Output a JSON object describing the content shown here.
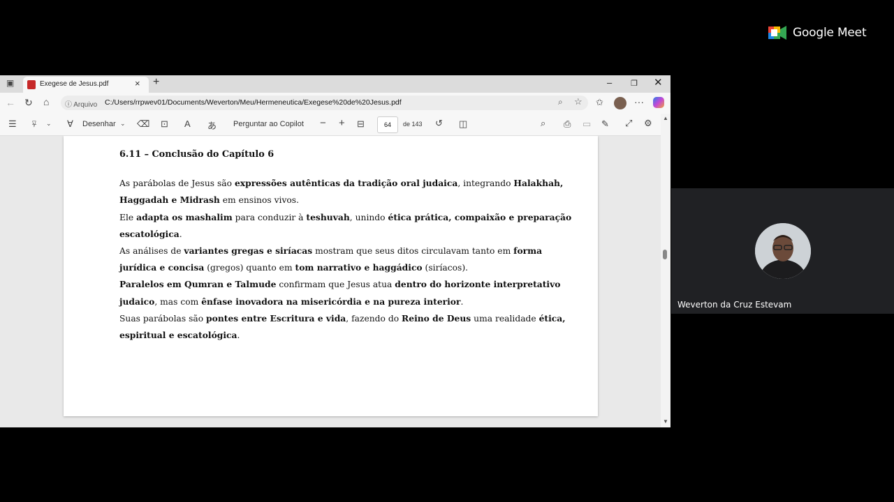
{
  "meet": {
    "brand": "Google Meet"
  },
  "participant": {
    "name": "Weverton da Cruz Estevam"
  },
  "browser": {
    "tab_title": "Exegese de Jesus.pdf",
    "address_prefix": "Arquivo",
    "url": "C:/Users/rrpwev01/Documents/Weverton/Meu/Hermeneutica/Exegese%20de%20Jesus.pdf"
  },
  "pdf_toolbar": {
    "draw_label": "Desenhar",
    "copilot_label": "Perguntar ao Copilot",
    "page_current": "64",
    "page_total_label": "de 143"
  },
  "document": {
    "heading": "6.11 – Conclusão do Capítulo 6",
    "paragraphs": [
      [
        {
          "t": "As parábolas de Jesus são "
        },
        {
          "t": "expressões autênticas da tradição oral judaica",
          "b": true
        },
        {
          "t": ", integrando "
        },
        {
          "t": "Halakhah, Haggadah e Midrash",
          "b": true
        },
        {
          "t": " em ensinos vivos."
        }
      ],
      [
        {
          "t": "Ele "
        },
        {
          "t": "adapta os mashalim",
          "b": true
        },
        {
          "t": " para conduzir à "
        },
        {
          "t": "teshuvah",
          "b": true
        },
        {
          "t": ", unindo "
        },
        {
          "t": "ética prática, compaixão e preparação escatológica",
          "b": true
        },
        {
          "t": "."
        }
      ],
      [
        {
          "t": "As análises de "
        },
        {
          "t": "variantes gregas e siríacas",
          "b": true
        },
        {
          "t": " mostram que seus ditos circulavam tanto em "
        },
        {
          "t": "forma jurídica e concisa",
          "b": true
        },
        {
          "t": " (gregos) quanto em "
        },
        {
          "t": "tom narrativo e haggádico",
          "b": true
        },
        {
          "t": " (siríacos)."
        }
      ],
      [
        {
          "t": "Paralelos em Qumran e Talmude",
          "b": true
        },
        {
          "t": " confirmam que Jesus atua "
        },
        {
          "t": "dentro do horizonte interpretativo judaico",
          "b": true
        },
        {
          "t": ", mas com "
        },
        {
          "t": "ênfase inovadora na misericórdia e na pureza interior",
          "b": true
        },
        {
          "t": "."
        }
      ],
      [
        {
          "t": "Suas parábolas são "
        },
        {
          "t": "pontes entre Escritura e vida",
          "b": true
        },
        {
          "t": ", fazendo do "
        },
        {
          "t": "Reino de Deus",
          "b": true
        },
        {
          "t": " uma realidade "
        },
        {
          "t": "ética, espiritual e escatológica",
          "b": true
        },
        {
          "t": "."
        }
      ]
    ]
  },
  "colors": {
    "page_bg": "#000000",
    "tile_bg": "#202124",
    "pdf_red": "#c62828"
  }
}
